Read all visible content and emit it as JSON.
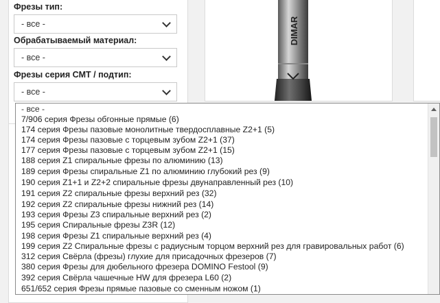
{
  "filters": {
    "type_label": "Фрезы тип:",
    "type_value": "- все -",
    "material_label": "Обрабатываемый материал:",
    "material_value": "- все -",
    "series_label": "Фрезы серия CMT / подтип:",
    "series_value": "- все -"
  },
  "product_image": {
    "brand_text": "DIMAR"
  },
  "dropdown": {
    "options": [
      "- все -",
      "7/906 серия Фрезы обгонные прямые (6)",
      "174 серия Фрезы пазовые монолитные твердосплавные Z2+1 (5)",
      "174 серия Фрезы пазовые с торцевым зубом Z2+1 (37)",
      "177 серия Фрезы пазовые с торцевым зубом Z2+1 (15)",
      "188 серия Z1 спиральные фрезы по алюминию (13)",
      "189 серия Фрезы спиральные Z1 по алюминию глубокий рез (9)",
      "190 серия Z1+1 и Z2+2 спиральные фрезы двунаправленный рез (10)",
      "191 серия Z2 спиральные фрезы верхний рез (32)",
      "192 серия Z2 спиральные фрезы нижний рез (14)",
      "193 серия Фрезы Z3 спиральные верхний рез (2)",
      "195 серия Спиральные фрезы Z3R (12)",
      "198 серия Фрезы Z1 спиральные верхний рез (4)",
      "199 серия Z2 Спиральные фрезы с радиусным торцом верхний рез для гравировальных работ (6)",
      "312 серия Свёрла (фрезы) глухие для присадочных фрезеров (7)",
      "380 серия Фрезы для дюбельного фрезера DOMINO Festool (9)",
      "392 серия Свёрла чашечные HW для фрезера L60 (2)",
      "651/652 серия Фрезы прямые пазовые со сменным ножом (1)"
    ]
  }
}
